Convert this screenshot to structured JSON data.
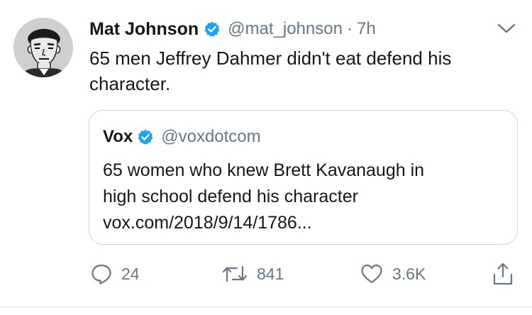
{
  "author": {
    "name": "Mat Johnson",
    "handle": "@mat_johnson",
    "separator": "·",
    "time": "7h",
    "verified": true
  },
  "tweet": {
    "text": "65 men Jeffrey Dahmer didn't eat defend his character."
  },
  "quoted": {
    "name": "Vox",
    "handle": "@voxdotcom",
    "verified": true,
    "text_line1": "65 women who knew Brett Kavanaugh in",
    "text_line2": "high school defend his character",
    "link": "vox.com/2018/9/14/1786..."
  },
  "actions": {
    "reply_count": "24",
    "retweet_count": "841",
    "like_count": "3.6K"
  },
  "colors": {
    "verified_blue": "#1da1f2",
    "text_primary": "#14171a",
    "text_secondary": "#657786",
    "border": "#ccd6dd"
  },
  "icons": [
    "avatar",
    "verified-badge-icon",
    "chevron-down-icon",
    "reply-icon",
    "retweet-icon",
    "like-icon",
    "share-icon"
  ]
}
